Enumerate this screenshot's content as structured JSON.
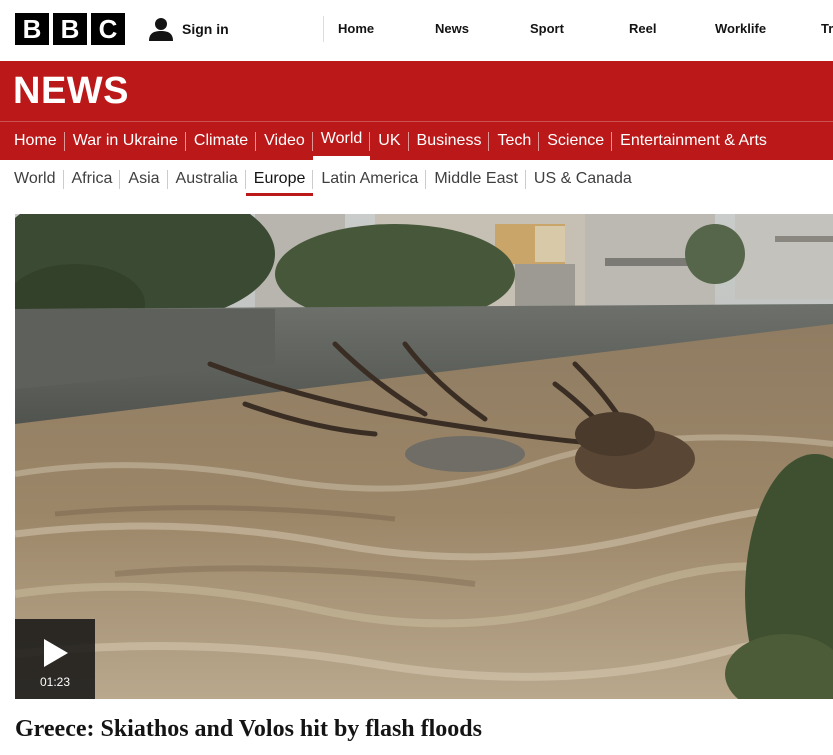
{
  "brand": {
    "logo_letters": [
      "B",
      "B",
      "C"
    ],
    "section_title": "NEWS",
    "color_red": "#bb1919"
  },
  "account": {
    "signin_label": "Sign in",
    "icon": "user-icon"
  },
  "top_nav": [
    "Home",
    "News",
    "Sport",
    "Reel",
    "Worklife",
    "Tr"
  ],
  "section_nav": {
    "items": [
      "Home",
      "War in Ukraine",
      "Climate",
      "Video",
      "World",
      "UK",
      "Business",
      "Tech",
      "Science",
      "Entertainment & Arts"
    ],
    "active": "World"
  },
  "sub_nav": {
    "items": [
      "World",
      "Africa",
      "Asia",
      "Australia",
      "Europe",
      "Latin America",
      "Middle East",
      "US & Canada"
    ],
    "active": "Europe"
  },
  "video": {
    "duration": "01:23",
    "icon": "play-icon",
    "headline": "Greece: Skiathos and Volos hit by flash floods"
  }
}
